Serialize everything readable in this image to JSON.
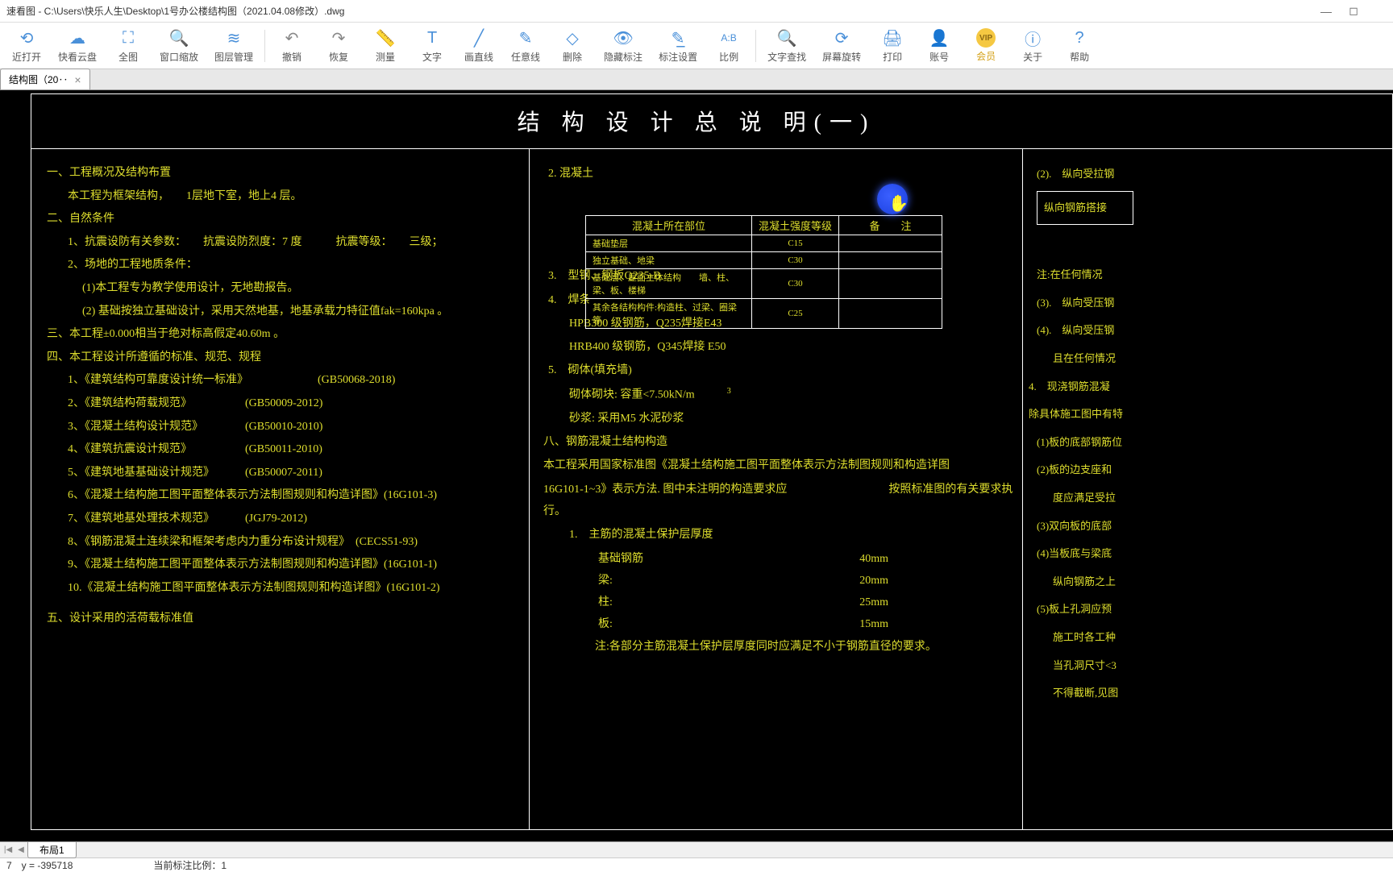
{
  "window": {
    "title": "速看图 - C:\\Users\\快乐人生\\Desktop\\1号办公楼结构图（2021.04.08修改）.dwg"
  },
  "toolbar": {
    "recent": "近打开",
    "cloud": "快看云盘",
    "fullview": "全图",
    "zoomwin": "窗口缩放",
    "layers": "图层管理",
    "undo": "撤销",
    "redo": "恢复",
    "measure": "测量",
    "text": "文字",
    "line": "画直线",
    "freeline": "任意线",
    "delete": "删除",
    "hidemark": "隐藏标注",
    "markset": "标注设置",
    "scale": "比例",
    "findtext": "文字查找",
    "rotate": "屏幕旋转",
    "print": "打印",
    "account": "账号",
    "vip": "会员",
    "about": "关于",
    "help": "帮助"
  },
  "tab": {
    "name": "结构图（20‥"
  },
  "drawing": {
    "title": "结 构 设 计 总 说 明(一)",
    "s1": "一、工程概况及结构布置",
    "s1_1": "本工程为框架结构，　　1层地下室，地上4 层。",
    "s2": "二、自然条件",
    "s2_1": "1、抗震设防有关参数：　　抗震设防烈度：7 度　　　抗震等级：　　三级；",
    "s2_2": "2、场地的工程地质条件：",
    "s2_2a": "(1)本工程专为教学使用设计，无地勘报告。",
    "s2_2b": "(2) 基础按独立基础设计，采用天然地基，地基承载力特征值fak=160kpa 。",
    "s3": "三、本工程±0.000相当于绝对标高假定40.60m 。",
    "s4": "四、本工程设计所遵循的标准、规范、规程",
    "specs": [
      {
        "name": "1、《建筑结构可靠度设计统一标准》",
        "code": "(GB50068-2018)"
      },
      {
        "name": "2、《建筑结构荷载规范》",
        "code": "(GB50009-2012)"
      },
      {
        "name": "3、《混凝土结构设计规范》",
        "code": "(GB50010-2010)"
      },
      {
        "name": "4、《建筑抗震设计规范》",
        "code": "(GB50011-2010)"
      },
      {
        "name": "5、《建筑地基基础设计规范》",
        "code": "(GB50007-2011)"
      }
    ],
    "spec6": "6、《混凝土结构施工图平面整体表示方法制图规则和构造详图》(16G101-3)",
    "spec7": "7、《建筑地基处理技术规范》",
    "spec7c": "(JGJ79-2012)",
    "spec8": "8、《钢筋混凝土连续梁和框架考虑内力重分布设计规程》　(CECS51-93)",
    "spec9": "9、《混凝土结构施工图平面整体表示方法制图规则和构造详图》(16G101-1)",
    "spec10": "10.《混凝土结构施工图平面整体表示方法制图规则和构造详图》(16G101-2)",
    "s5": "五、设计采用的活荷载标准值",
    "c2_2": "2. 混凝土",
    "table": {
      "h1": "混凝土所在部位",
      "h2": "混凝土强度等级",
      "h3": "备　　注",
      "r1a": "基础垫层",
      "r1b": "C15",
      "r2a": "独立基础、地梁",
      "r2b": "C30",
      "r3a": "基础层、屋面主体结构　　墙、柱、梁、板、楼梯",
      "r3b": "C30",
      "r4a": "其余各结构构件:构造柱、过梁、圈梁等",
      "r4b": "C25"
    },
    "c2_3": "3.　型钢、钢板Q235-B",
    "c2_4": "4.　焊条",
    "c2_4a": "HPB300 级钢筋，Q235焊接E43",
    "c2_4b": "HRB400 级钢筋，Q345焊接 E50",
    "c2_5": "5.　砌体(填充墙)",
    "c2_5a": "砌体砌块: 容重<7.50kN/m",
    "c2_5a_sup": "3",
    "c2_5b": "砂浆: 采用M5 水泥砂浆",
    "c2_8": "八、钢筋混凝土结构构造",
    "c2_8a": "本工程采用国家标准图《混凝土结构施工图平面整体表示方法制图规则和构造详图",
    "c2_8b": "16G101-1~3》表示方法. 图中未注明的构造要求应　　　　　　　　　按照标准图的有关要求执行。",
    "c2_8_1": "1.　主筋的混凝土保护层厚度",
    "cover": [
      {
        "name": "基础钢筋",
        "val": "40mm"
      },
      {
        "name": "梁:",
        "val": "20mm"
      },
      {
        "name": "柱:",
        "val": "25mm"
      },
      {
        "name": "板:",
        "val": "15mm"
      }
    ],
    "c2_note": "注:各部分主筋混凝土保护层厚度同时应满足不小于钢筋直径的要求。",
    "c3_2": "(2).　纵向受拉钢",
    "c3_box": "纵向钢筋搭接",
    "c3_note": "注:在任何情况",
    "c3_3": "(3).　纵向受压钢",
    "c3_4": "(4).　纵向受压钢",
    "c3_4a": "且在任何情况",
    "c3_s4": "4.　现浇钢筋混凝",
    "c3_s4a": "除具体施工图中有特",
    "c3_s4_1": "(1)板的底部钢筋位",
    "c3_s4_2": "(2)板的边支座和",
    "c3_s4_2a": "度应满足受拉",
    "c3_s4_3": "(3)双向板的底部",
    "c3_s4_4": "(4)当板底与梁底",
    "c3_s4_4a": "纵向钢筋之上",
    "c3_s4_5": "(5)板上孔洞应预",
    "c3_s4_5a": "施工时各工种",
    "c3_s4_5b": "当孔洞尺寸<3",
    "c3_s4_5c": "不得截断,见图"
  },
  "footer": {
    "layout": "布局1"
  },
  "status": {
    "coords": "7　y = -395718",
    "scale": "当前标注比例：1"
  }
}
